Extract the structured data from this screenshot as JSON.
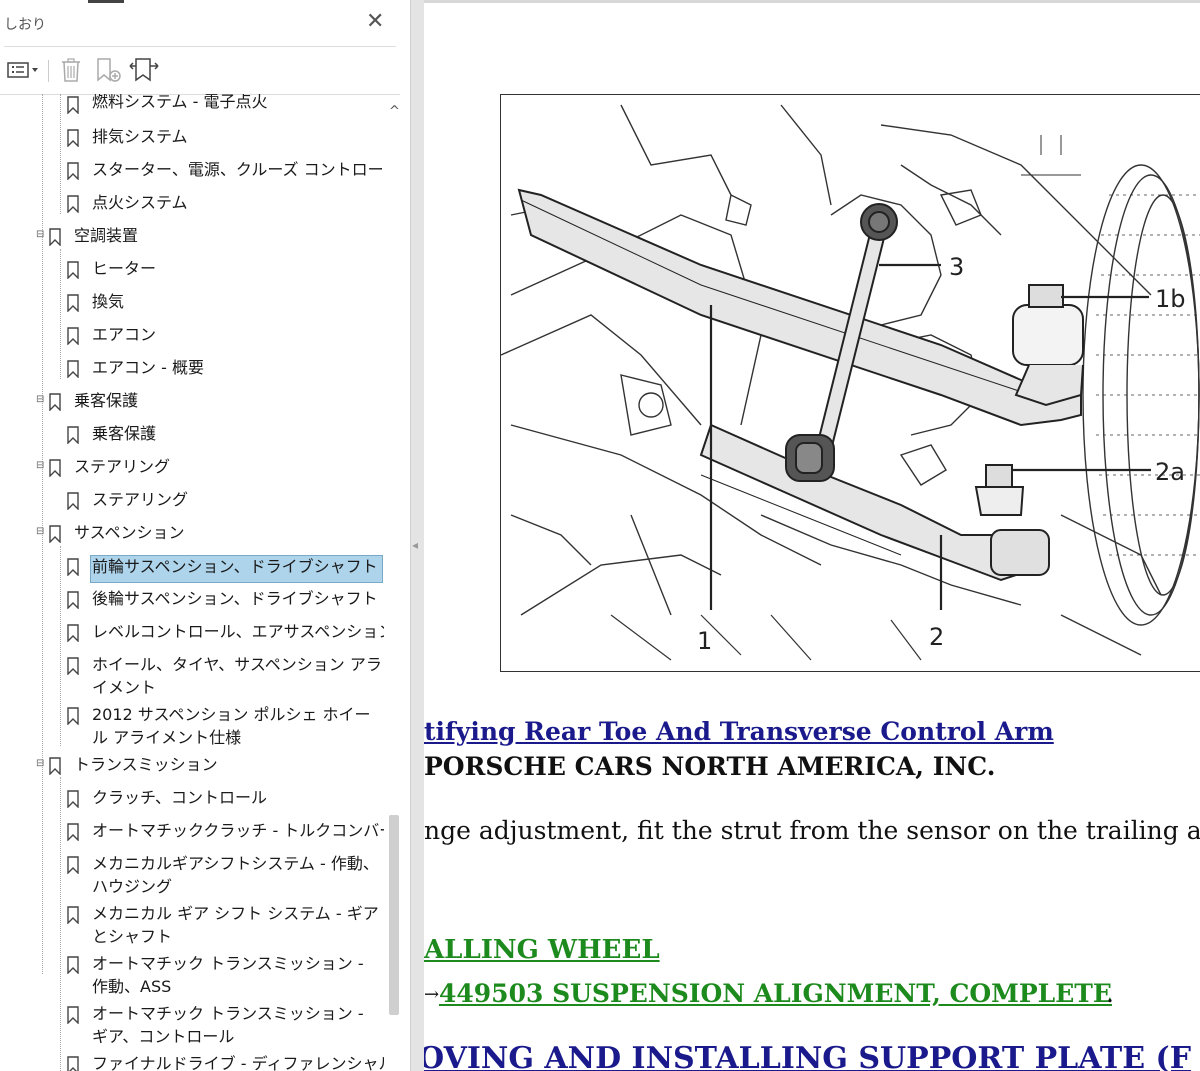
{
  "sidebar": {
    "title": "しおり",
    "close_label": "✕",
    "toolbar": {
      "options_icon": "options-list-icon",
      "delete_icon": "trash-icon",
      "new_icon": "new-bookmark-icon",
      "find_icon": "find-bookmark-icon"
    },
    "items": [
      {
        "label": "燃料システム - 電子点火",
        "level": 2
      },
      {
        "label": "排気システム",
        "level": 2
      },
      {
        "label": "スターター、電源、クルーズ コントロール",
        "level": 2
      },
      {
        "label": "点火システム",
        "level": 2
      },
      {
        "label": "空調装置",
        "level": 1,
        "expanded": true
      },
      {
        "label": "ヒーター",
        "level": 2
      },
      {
        "label": "換気",
        "level": 2
      },
      {
        "label": "エアコン",
        "level": 2
      },
      {
        "label": "エアコン - 概要",
        "level": 2
      },
      {
        "label": "乗客保護",
        "level": 1,
        "expanded": true
      },
      {
        "label": "乗客保護",
        "level": 2
      },
      {
        "label": "ステアリング",
        "level": 1,
        "expanded": true
      },
      {
        "label": "ステアリング",
        "level": 2
      },
      {
        "label": "サスペンション",
        "level": 1,
        "expanded": true
      },
      {
        "label": "前輪サスペンション、ドライブシャフト",
        "level": 2,
        "selected": true
      },
      {
        "label": "後輪サスペンション、ドライブシャフト",
        "level": 2
      },
      {
        "label": "レベルコントロール、エアサスペンション",
        "level": 2
      },
      {
        "label": " ホイール、タイヤ、サスペンション アライメント",
        "level": 2
      },
      {
        "label": "2012 サスペンション ポルシェ ホイール アライメント仕様",
        "level": 2
      },
      {
        "label": "トランスミッション",
        "level": 1,
        "expanded": true
      },
      {
        "label": "クラッチ、コントロール",
        "level": 2
      },
      {
        "label": "オートマチッククラッチ - トルクコンバーター",
        "level": 2
      },
      {
        "label": "メカニカルギアシフトシステム - 作動、ハウジング",
        "level": 2
      },
      {
        "label": "メカニカル ギア シフト システム - ギアとシャフト",
        "level": 2
      },
      {
        "label": "オートマチック トランスミッション - 作動、ASS",
        "level": 2
      },
      {
        "label": "オートマチック トランスミッション - ギア、コントロール",
        "level": 2
      },
      {
        "label": "ファイナルドライブ - ディファレンシャル、ディ",
        "level": 2
      }
    ]
  },
  "document": {
    "figure_labels": [
      "3",
      "1b",
      "2a",
      "1",
      "2"
    ],
    "heading_link": "tifying Rear Toe And Transverse Control Arm",
    "company": "PORSCHE CARS NORTH AMERICA, INC.",
    "body_text": "nge adjustment, fit the strut from the sensor on the trailing arm (le",
    "section_link": "ALLING WHEEL",
    "arrow": "→",
    "ref_link": "449503 SUSPENSION ALIGNMENT, COMPLETE",
    "ref_suffix": ".",
    "bottom_link": "OVING AND INSTALLING SUPPORT PLATE (F"
  }
}
